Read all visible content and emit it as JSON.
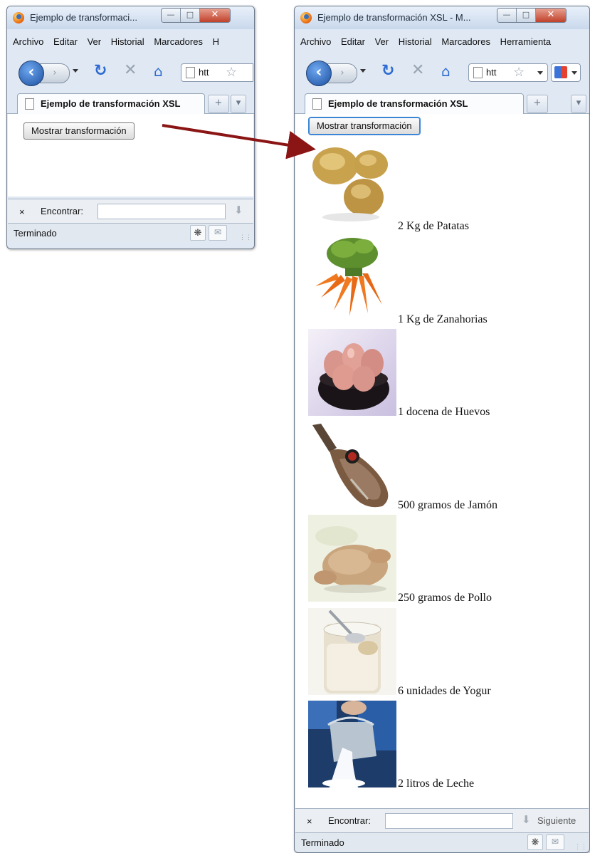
{
  "left_window": {
    "title": "Ejemplo de transformaci...",
    "menu": [
      "Archivo",
      "Editar",
      "Ver",
      "Historial",
      "Marcadores",
      "H"
    ],
    "url_text": "htt",
    "tab_title": "Ejemplo de transformación XSL",
    "button_label": "Mostrar transformación",
    "find_close": "×",
    "find_label": "Encontrar:",
    "status": "Terminado"
  },
  "right_window": {
    "title": "Ejemplo de transformación XSL - M...",
    "menu": [
      "Archivo",
      "Editar",
      "Ver",
      "Historial",
      "Marcadores",
      "Herramienta"
    ],
    "url_text": "htt",
    "tab_title": "Ejemplo de transformación XSL",
    "button_label": "Mostrar transformación",
    "items": [
      {
        "label": "2 Kg de Patatas",
        "icon": "potatoes-image"
      },
      {
        "label": "1 Kg de Zanahorias",
        "icon": "carrots-image"
      },
      {
        "label": "1 docena de Huevos",
        "icon": "eggs-image"
      },
      {
        "label": "500 gramos de Jamón",
        "icon": "ham-image"
      },
      {
        "label": "250 gramos de Pollo",
        "icon": "chicken-image"
      },
      {
        "label": "6 unidades de Yogur",
        "icon": "yogurt-image"
      },
      {
        "label": "2 litros de Leche",
        "icon": "milk-image"
      }
    ],
    "find_close": "×",
    "find_label": "Encontrar:",
    "find_next": "Siguiente",
    "status": "Terminado"
  },
  "colors": {
    "arrow": "#8b1414",
    "window_frame": "#dfe8f3",
    "close_button": "#c0412a"
  }
}
